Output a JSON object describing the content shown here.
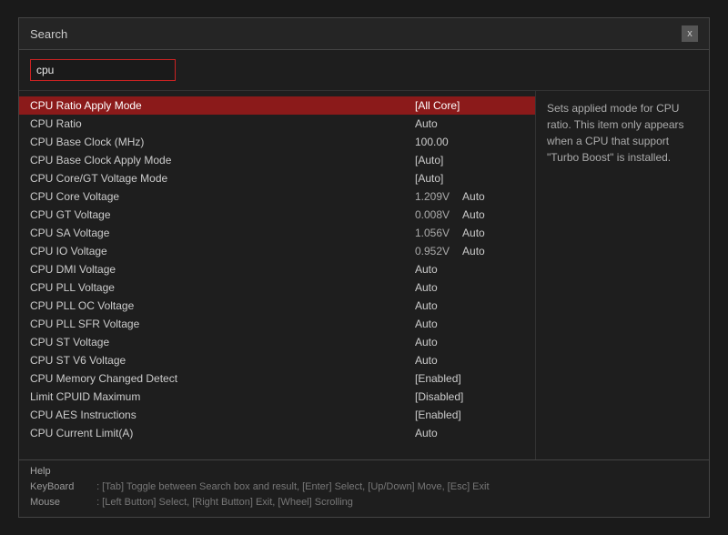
{
  "dialog": {
    "title": "Search",
    "close_label": "x"
  },
  "search": {
    "value": "cpu",
    "placeholder": ""
  },
  "results": [
    {
      "name": "CPU Ratio Apply Mode",
      "subvalue": "",
      "value": "[All Core]",
      "highlighted": true
    },
    {
      "name": "CPU Ratio",
      "subvalue": "",
      "value": "Auto",
      "highlighted": false
    },
    {
      "name": "CPU Base Clock (MHz)",
      "subvalue": "",
      "value": "100.00",
      "highlighted": false
    },
    {
      "name": "CPU Base Clock Apply Mode",
      "subvalue": "",
      "value": "[Auto]",
      "highlighted": false
    },
    {
      "name": "CPU Core/GT Voltage Mode",
      "subvalue": "",
      "value": "[Auto]",
      "highlighted": false
    },
    {
      "name": "CPU Core Voltage",
      "subvalue": "1.209V",
      "value": "Auto",
      "highlighted": false
    },
    {
      "name": "CPU GT Voltage",
      "subvalue": "0.008V",
      "value": "Auto",
      "highlighted": false
    },
    {
      "name": "CPU SA Voltage",
      "subvalue": "1.056V",
      "value": "Auto",
      "highlighted": false
    },
    {
      "name": "CPU IO Voltage",
      "subvalue": "0.952V",
      "value": "Auto",
      "highlighted": false
    },
    {
      "name": "CPU DMI Voltage",
      "subvalue": "",
      "value": "Auto",
      "highlighted": false
    },
    {
      "name": "CPU PLL Voltage",
      "subvalue": "",
      "value": "Auto",
      "highlighted": false
    },
    {
      "name": "CPU PLL OC Voltage",
      "subvalue": "",
      "value": "Auto",
      "highlighted": false
    },
    {
      "name": "CPU PLL SFR Voltage",
      "subvalue": "",
      "value": "Auto",
      "highlighted": false
    },
    {
      "name": "CPU ST Voltage",
      "subvalue": "",
      "value": "Auto",
      "highlighted": false
    },
    {
      "name": "CPU ST V6 Voltage",
      "subvalue": "",
      "value": "Auto",
      "highlighted": false
    },
    {
      "name": "CPU Memory Changed Detect",
      "subvalue": "",
      "value": "[Enabled]",
      "highlighted": false
    },
    {
      "name": "Limit CPUID Maximum",
      "subvalue": "",
      "value": "[Disabled]",
      "highlighted": false
    },
    {
      "name": "CPU AES Instructions",
      "subvalue": "",
      "value": "[Enabled]",
      "highlighted": false
    },
    {
      "name": "CPU Current Limit(A)",
      "subvalue": "",
      "value": "Auto",
      "highlighted": false
    }
  ],
  "info": {
    "text": "Sets applied mode for CPU ratio. This item only appears when a CPU that support \"Turbo Boost\" is installed."
  },
  "help": {
    "title": "Help",
    "keyboard_label": "KeyBoard",
    "keyboard_text": ": [Tab] Toggle between Search box and result, [Enter] Select, [Up/Down] Move, [Esc] Exit",
    "mouse_label": "Mouse",
    "mouse_text": ": [Left Button] Select, [Right Button] Exit, [Wheel] Scrolling"
  }
}
